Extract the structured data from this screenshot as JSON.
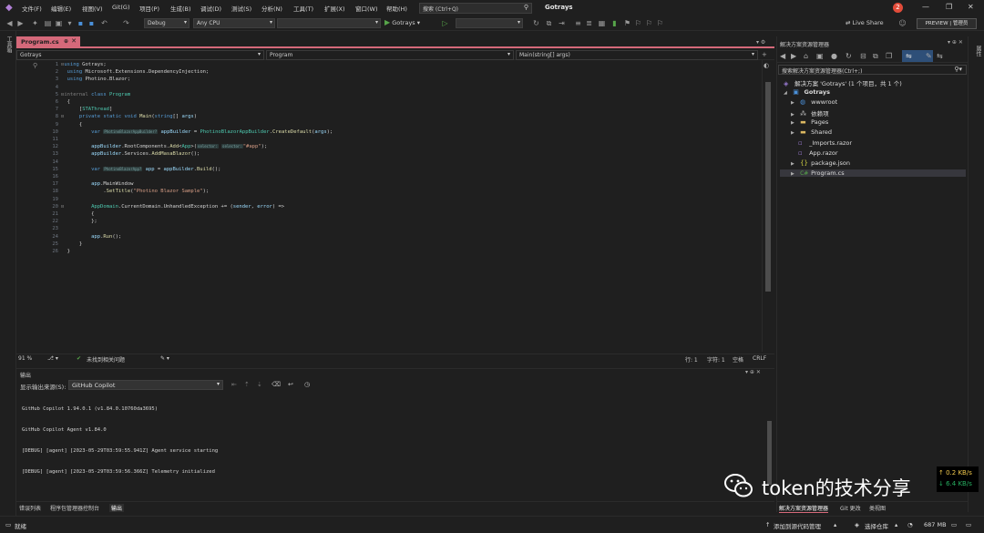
{
  "titlebar": {
    "menus": [
      "文件(F)",
      "编辑(E)",
      "视图(V)",
      "Git(G)",
      "项目(P)",
      "生成(B)",
      "调试(D)",
      "测试(S)",
      "分析(N)",
      "工具(T)",
      "扩展(X)",
      "窗口(W)",
      "帮助(H)"
    ],
    "search_placeholder": "搜索 (Ctrl+Q)",
    "app_title": "Gotrays",
    "notification_count": "2"
  },
  "toolbar": {
    "config": "Debug",
    "platform": "Any CPU",
    "run_label": "Gotrays",
    "live_share": "Live Share",
    "preview": "PREVIEW | 管理员"
  },
  "left_strip": {
    "label": "工具箱"
  },
  "editor": {
    "tab_title": "Program.cs",
    "nav_project": "Gotrays",
    "nav_class": "Program",
    "nav_member": "Main(string[] args)",
    "line_numbers": [
      "1",
      "2",
      "3",
      "4",
      "5",
      "6",
      "7",
      "8",
      "9",
      "10",
      "11",
      "12",
      "13",
      "14",
      "15",
      "16",
      "17",
      "18",
      "19",
      "20",
      "21",
      "22",
      "23",
      "24",
      "25",
      "26"
    ],
    "status": {
      "zoom": "91 %",
      "issues": "未找到相关问题",
      "line": "行: 1",
      "char": "字符: 1",
      "spaces": "空格",
      "eol": "CRLF"
    }
  },
  "output": {
    "title": "输出",
    "source_label": "显示输出来源(S):",
    "source_value": "GitHub Copilot",
    "lines": [
      "GitHub Copilot 1.94.0.1 (v1.84.0.10760da3695)",
      "GitHub Copilot Agent v1.84.0",
      "[DEBUG] [agent] [2023-05-29T03:59:55.941Z] Agent service starting",
      "[DEBUG] [agent] [2023-05-29T03:59:56.366Z] Telemetry initialized"
    ]
  },
  "bottom_tabs": [
    "错误列表",
    "程序包管理器控制台",
    "输出"
  ],
  "solution_explorer": {
    "title": "解决方案资源管理器",
    "search_placeholder": "搜索解决方案资源管理器(Ctrl+;)",
    "solution": "解决方案 'Gotrays' (1 个项目，共 1 个)",
    "project": "Gotrays",
    "items": [
      "wwwroot",
      "依赖项",
      "Pages",
      "Shared",
      "_Imports.razor",
      "App.razor",
      "package.json",
      "Program.cs"
    ],
    "bottom_tabs": [
      "解决方案资源管理器",
      "Git 更改",
      "类视图"
    ]
  },
  "right_strip": {
    "label": "属性"
  },
  "statusbar": {
    "ready": "就绪",
    "add_source": "添加到源代码管理",
    "select_repo": "选择仓库",
    "memory": "687 MB"
  },
  "network": {
    "up": "↑ 0.2 KB/s",
    "down": "↓ 6.4 KB/s"
  },
  "watermark": {
    "text": "token的技术分享"
  },
  "colors": {
    "accent_tab": "#d5697a",
    "keyword": "#569cd6",
    "type": "#4ec9b0",
    "method": "#dcdcaa",
    "string": "#d69d85"
  }
}
